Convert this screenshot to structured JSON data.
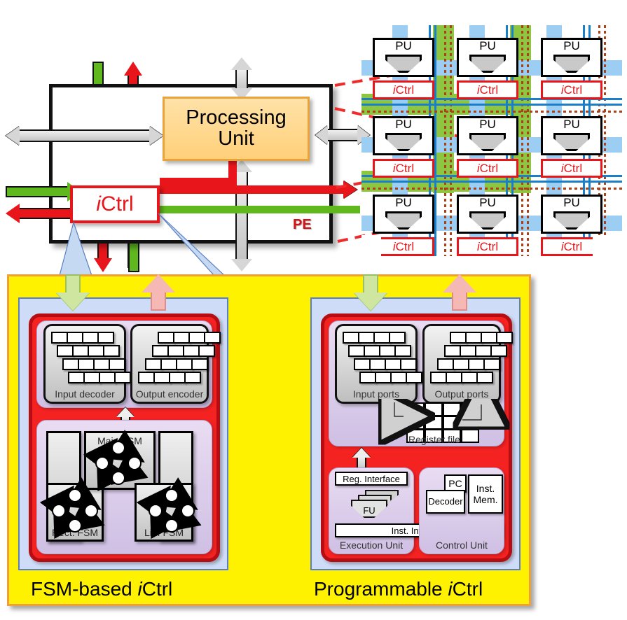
{
  "pe_diagram": {
    "processing_unit_label": "Processing\nUnit",
    "processing_unit_line1": "Processing",
    "processing_unit_line2": "Unit",
    "ictrl_label_i": "i",
    "ictrl_label_rest": "Ctrl",
    "pe_label": "PE"
  },
  "grid": {
    "pu_label": "PU",
    "ictrl_i": "i",
    "ictrl_rest": "Ctrl",
    "cells": [
      {
        "pu": "PU",
        "ictrl": "iCtrl"
      },
      {
        "pu": "PU",
        "ictrl": "iCtrl"
      },
      {
        "pu": "PU",
        "ictrl": "iCtrl"
      },
      {
        "pu": "PU",
        "ictrl": "iCtrl"
      },
      {
        "pu": "PU",
        "ictrl": "iCtrl"
      },
      {
        "pu": "PU",
        "ictrl": "iCtrl"
      },
      {
        "pu": "PU",
        "ictrl": "iCtrl"
      },
      {
        "pu": "PU",
        "ictrl": "iCtrl"
      },
      {
        "pu": "PU",
        "ictrl": "iCtrl"
      }
    ]
  },
  "fsm_panel": {
    "caption_main": "FSM-based ",
    "caption_i": "i",
    "caption_rest": "Ctrl",
    "input_decoder": "Input decoder",
    "output_encoder": "Output encoder",
    "main_fsm": "Main FSM",
    "rect_fsm": "Rect. FSM",
    "lin_fsm": "Lin. FSM"
  },
  "prog_panel": {
    "caption_main": "Programmable ",
    "caption_i": "i",
    "caption_rest": "Ctrl",
    "input_ports": "Input ports",
    "output_ports": "Output ports",
    "register_file": "Register file",
    "reg_interface": "Reg. Interface",
    "inst_interface": "Inst. Interface",
    "fu": "FU",
    "pc": "PC",
    "decoder": "Decoder",
    "inst_mem_line1": "Inst.",
    "inst_mem_line2": "Mem.",
    "execution_unit": "Execution Unit",
    "control_unit": "Control Unit"
  },
  "colors": {
    "yellow": "#fff200",
    "red_panel": "#f52222",
    "red_border": "#b50d12",
    "blue_panel": "#cfdcf7",
    "lavender": "#cfc0e4",
    "grid_green": "#8ec642",
    "grid_blue": "#9ccdf2",
    "ictrl_red": "#e8161a",
    "pu_orange": "#ffd07a",
    "dash_red": "#ef2a2a",
    "green_arrow": "#5fb81d",
    "grey_arrow": "#c4c4c4"
  }
}
